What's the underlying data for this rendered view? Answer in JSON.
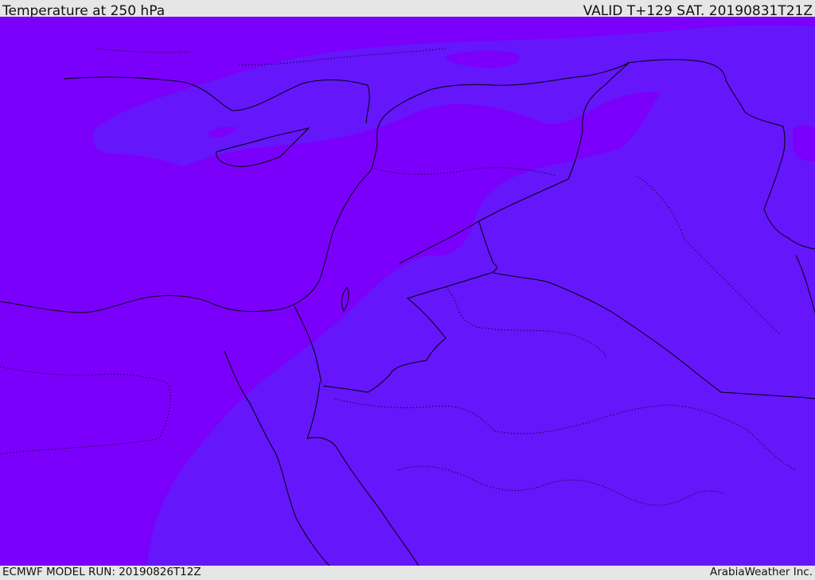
{
  "header": {
    "title": "Temperature at 250 hPa",
    "valid": "VALID T+129 SAT. 20190831T21Z"
  },
  "footer": {
    "model_run": "ECMWF MODEL RUN: 20190826T12Z",
    "credit": "ArabiaWeather Inc."
  },
  "map": {
    "colors": {
      "warmer_band": "#7a00fb",
      "cooler_band": "#6516fb",
      "coastline": "#000000",
      "border": "#000000"
    }
  }
}
